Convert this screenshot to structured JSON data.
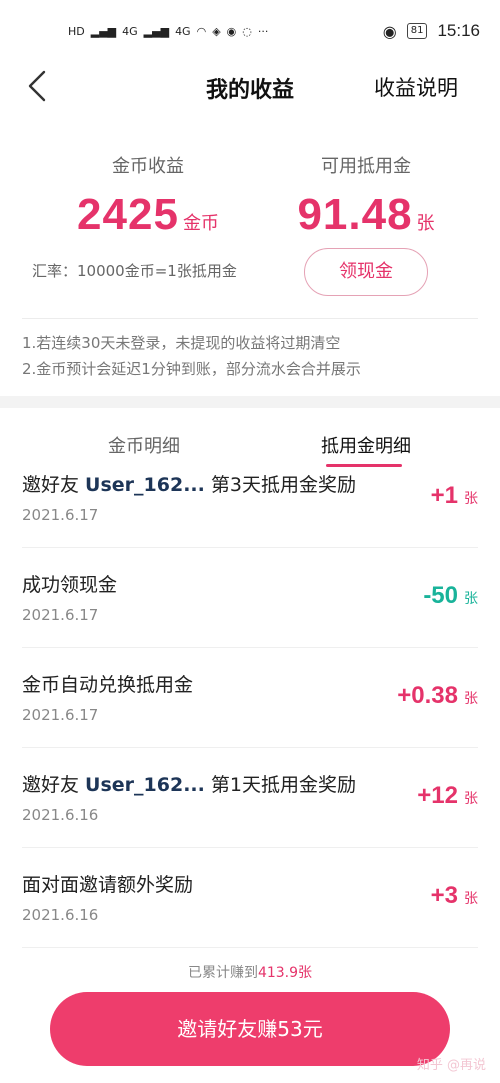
{
  "status_bar": {
    "left_badges": [
      "HD",
      "4G",
      "4G"
    ],
    "battery": "81",
    "time": "15:16"
  },
  "header": {
    "title": "我的收益",
    "help_link": "收益说明"
  },
  "summary": {
    "coins_label": "金币收益",
    "coins_value": "2425",
    "coins_unit": "金币",
    "voucher_label": "可用抵用金",
    "voucher_value": "91.48",
    "voucher_unit": "张",
    "rate_text": "汇率：10000金币=1张抵用金",
    "withdraw_label": "领现金"
  },
  "notes": [
    "1.若连续30天未登录，未提现的收益将过期清空",
    "2.金币预计会延迟1分钟到账，部分流水会合并展示"
  ],
  "tabs": {
    "coins_detail": "金币明细",
    "voucher_detail": "抵用金明细"
  },
  "records": [
    {
      "prefix": "邀好友 ",
      "user": "User_162...",
      "suffix": " 第3天抵用金奖励",
      "date": "2021.6.17",
      "amount": "+1",
      "unit": "张",
      "sign": "pos"
    },
    {
      "prefix": "成功领现金",
      "user": "",
      "suffix": "",
      "date": "2021.6.17",
      "amount": "-50",
      "unit": "张",
      "sign": "neg"
    },
    {
      "prefix": "金币自动兑换抵用金",
      "user": "",
      "suffix": "",
      "date": "2021.6.17",
      "amount": "+0.38",
      "unit": "张",
      "sign": "pos"
    },
    {
      "prefix": "邀好友 ",
      "user": "User_162...",
      "suffix": " 第1天抵用金奖励",
      "date": "2021.6.16",
      "amount": "+12",
      "unit": "张",
      "sign": "pos"
    },
    {
      "prefix": "面对面邀请额外奖励",
      "user": "",
      "suffix": "",
      "date": "2021.6.16",
      "amount": "+3",
      "unit": "张",
      "sign": "pos"
    }
  ],
  "footer": {
    "total_prefix": "已累计赚到",
    "total_value": "413.9张",
    "invite_button": "邀请好友赚53元",
    "watermark": "知乎 @再说"
  },
  "colors": {
    "accent": "#e5336a",
    "negative": "#19b39a",
    "button": "#ee3d6c"
  }
}
